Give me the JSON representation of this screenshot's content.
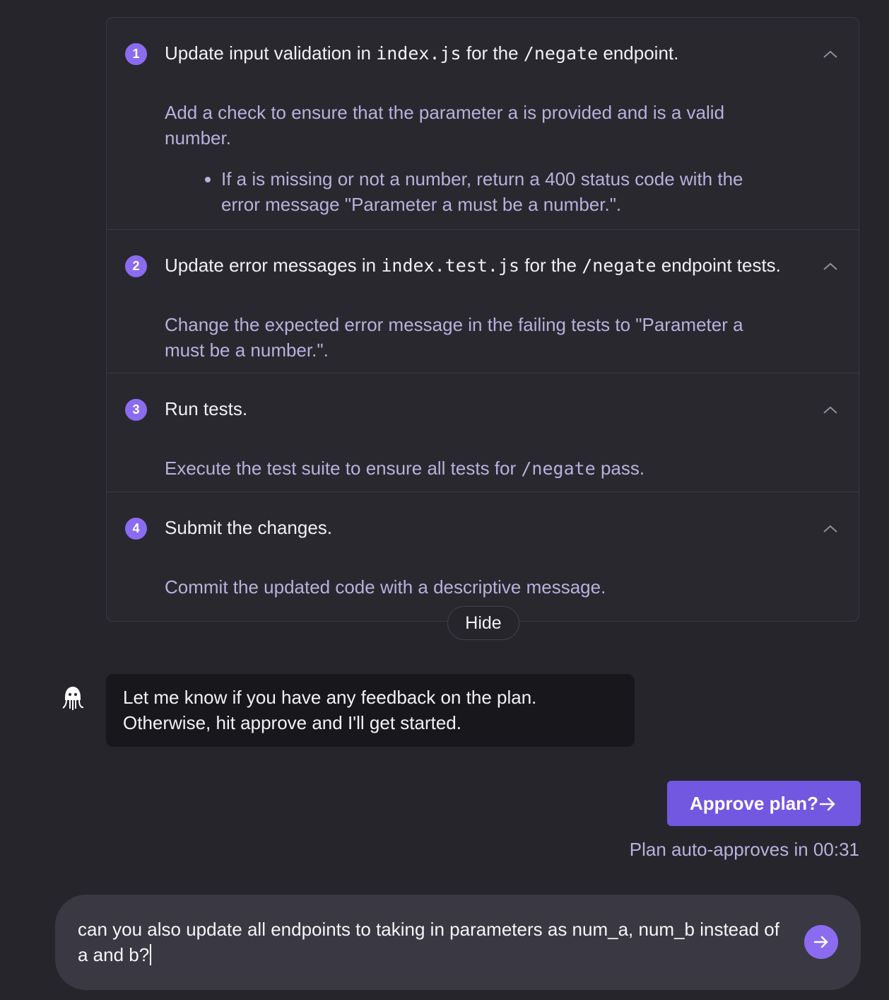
{
  "plan": {
    "steps": [
      {
        "number": "1",
        "title_parts": {
          "t1": "Update input validation in ",
          "c1": "index.js",
          "t2": " for the ",
          "c2": "/negate",
          "t3": " endpoint."
        },
        "description": "Add a check to ensure that the parameter a is provided and is a valid number.",
        "bullets": [
          "If a is missing or not a number, return a 400 status code with the error message \"Parameter a must be a number.\"."
        ]
      },
      {
        "number": "2",
        "title_parts": {
          "t1": "Update error messages in ",
          "c1": "index.test.js",
          "t2": " for the ",
          "c2": "/negate",
          "t3": " endpoint tests."
        },
        "description": "Change the expected error message in the failing tests to \"Parameter a must be a number.\"."
      },
      {
        "number": "3",
        "title": "Run tests.",
        "description_parts": {
          "t1": "Execute the test suite to ensure all tests for ",
          "c1": "/negate",
          "t2": " pass."
        }
      },
      {
        "number": "4",
        "title": "Submit the changes.",
        "description": "Commit the updated code with a descriptive message."
      }
    ],
    "hide_label": "Hide"
  },
  "assistant_message": {
    "line1": "Let me know if you have any feedback on the plan.",
    "line2": "Otherwise, hit approve and I'll get started."
  },
  "approve": {
    "label": "Approve plan?",
    "auto_approve_text": "Plan auto-approves in 00:31"
  },
  "composer": {
    "value": "can you also update all endpoints to taking in parameters as num_a, num_b instead of a and b?"
  },
  "colors": {
    "background": "#26252c",
    "accent": "#7257e0",
    "badge": "#8b6cf0",
    "muted_text": "#b8b1dc"
  },
  "icons": {
    "collapse": "chevron-up-icon",
    "avatar": "octopus-icon",
    "approve": "arrow-right-icon",
    "send": "arrow-right-icon"
  }
}
